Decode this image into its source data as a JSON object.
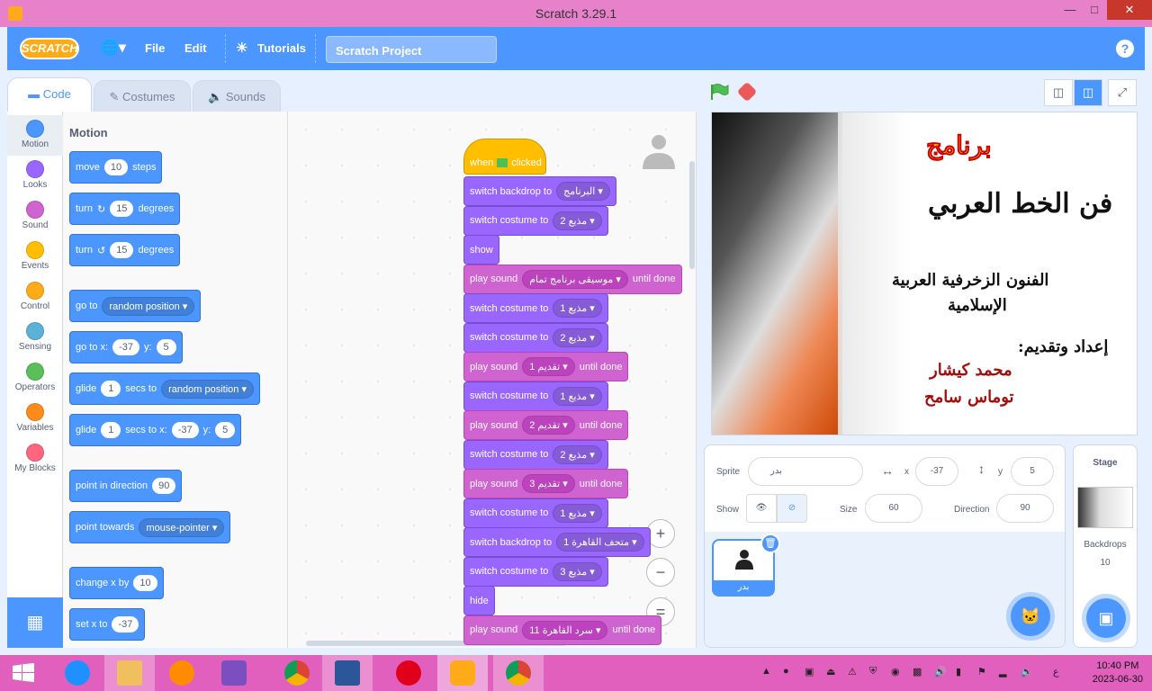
{
  "window": {
    "title": "Scratch 3.29.1"
  },
  "menu": {
    "logo": "SCRATCH",
    "file": "File",
    "edit": "Edit",
    "tutorials": "Tutorials",
    "project_title": "Scratch Project",
    "help": "?"
  },
  "tabs": {
    "code": "Code",
    "costumes": "Costumes",
    "sounds": "Sounds"
  },
  "categories": [
    {
      "label": "Motion",
      "color": "#4c97ff"
    },
    {
      "label": "Looks",
      "color": "#9966ff"
    },
    {
      "label": "Sound",
      "color": "#cf63cf"
    },
    {
      "label": "Events",
      "color": "#ffbf00"
    },
    {
      "label": "Control",
      "color": "#ffab19"
    },
    {
      "label": "Sensing",
      "color": "#5cb1d6"
    },
    {
      "label": "Operators",
      "color": "#59c059"
    },
    {
      "label": "Variables",
      "color": "#ff8c1a"
    },
    {
      "label": "My Blocks",
      "color": "#ff6680"
    }
  ],
  "palette": {
    "title": "Motion",
    "move": {
      "a": "move",
      "v": "10",
      "b": "steps"
    },
    "turn_right": {
      "a": "turn",
      "v": "15",
      "b": "degrees"
    },
    "turn_left": {
      "a": "turn",
      "v": "15",
      "b": "degrees"
    },
    "goto": {
      "a": "go to",
      "dd": "random position"
    },
    "gotoxy": {
      "a": "go to x:",
      "x": "-37",
      "b": "y:",
      "y": "5"
    },
    "glide": {
      "a": "glide",
      "v": "1",
      "b": "secs to",
      "dd": "random position"
    },
    "glidexy": {
      "a": "glide",
      "v": "1",
      "b": "secs to x:",
      "x": "-37",
      "c": "y:",
      "y": "5"
    },
    "point": {
      "a": "point in direction",
      "v": "90"
    },
    "towards": {
      "a": "point towards",
      "dd": "mouse-pointer"
    },
    "changex": {
      "a": "change x by",
      "v": "10"
    },
    "setx": {
      "a": "set x to",
      "v": "-37"
    }
  },
  "script": {
    "hat": {
      "a": "when",
      "b": "clicked"
    },
    "blocks": [
      {
        "kind": "looks",
        "a": "switch backdrop to",
        "dd": "البرنامج",
        "b": ""
      },
      {
        "kind": "looks",
        "a": "switch costume to",
        "dd": "مذيع 2",
        "b": ""
      },
      {
        "kind": "looks",
        "a": "show",
        "dd": "",
        "b": ""
      },
      {
        "kind": "sound",
        "a": "play sound",
        "dd": "موسيقى برنامج تمام",
        "b": "until done"
      },
      {
        "kind": "looks",
        "a": "switch costume to",
        "dd": "مذيع 1",
        "b": ""
      },
      {
        "kind": "looks",
        "a": "switch costume to",
        "dd": "مذيع 2",
        "b": ""
      },
      {
        "kind": "sound",
        "a": "play sound",
        "dd": "تقديم 1",
        "b": "until done"
      },
      {
        "kind": "looks",
        "a": "switch costume to",
        "dd": "مذيع 1",
        "b": ""
      },
      {
        "kind": "sound",
        "a": "play sound",
        "dd": "تقديم 2",
        "b": "until done"
      },
      {
        "kind": "looks",
        "a": "switch costume to",
        "dd": "مذيع 2",
        "b": ""
      },
      {
        "kind": "sound",
        "a": "play sound",
        "dd": "تقديم 3",
        "b": "until done"
      },
      {
        "kind": "looks",
        "a": "switch costume to",
        "dd": "مذيع 1",
        "b": ""
      },
      {
        "kind": "looks",
        "a": "switch backdrop to",
        "dd": "متحف القاهرة 1",
        "b": ""
      },
      {
        "kind": "looks",
        "a": "switch costume to",
        "dd": "مذيع 3",
        "b": ""
      },
      {
        "kind": "looks",
        "a": "hide",
        "dd": "",
        "b": ""
      },
      {
        "kind": "sound",
        "a": "play sound",
        "dd": "سرد القاهرة 11",
        "b": "until done"
      }
    ],
    "zoom_in": "+",
    "zoom_out": "−",
    "zoom_reset": "="
  },
  "stage": {
    "title_word": "برنامج",
    "callig_main": "فن الخط العربي",
    "line1": "الفنون الزخرفية العربية",
    "line2": "الإسلامية",
    "prepared_by": "إعداد وتقديم:",
    "name1": "محمد كيشار",
    "name2": "توماس سامح"
  },
  "sprite_info": {
    "sprite_label": "Sprite",
    "sprite_name": "بدر",
    "x_label": "x",
    "x": "-37",
    "y_label": "y",
    "y": "5",
    "show_label": "Show",
    "size_label": "Size",
    "size": "60",
    "direction_label": "Direction",
    "direction": "90",
    "card_name": "بدر"
  },
  "stage_panel": {
    "title": "Stage",
    "backdrops_label": "Backdrops",
    "backdrops_count": "10"
  },
  "clock": {
    "time": "10:40 PM",
    "date": "2023-06-30",
    "lang": "ع"
  },
  "colors": {
    "motion": "#4c97ff",
    "looks": "#9966ff",
    "sound": "#cf63cf",
    "events": "#ffbf00",
    "titlebar": "#e781c9"
  }
}
